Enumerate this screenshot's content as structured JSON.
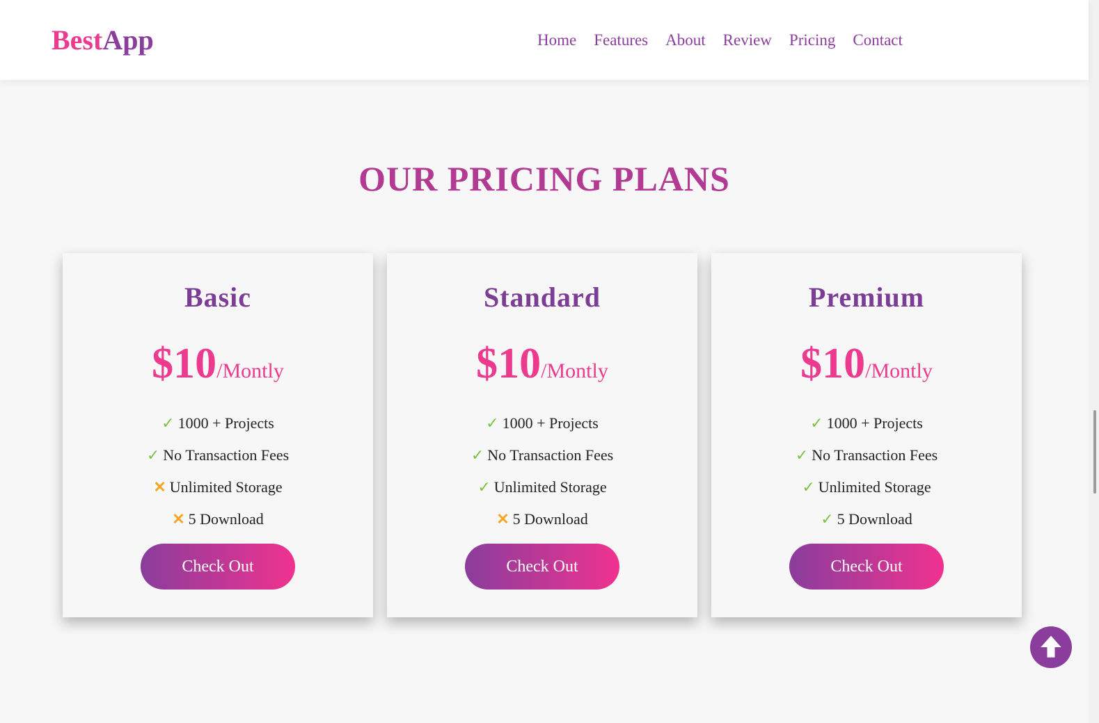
{
  "header": {
    "logo_part1": "Best",
    "logo_part2": "App",
    "nav": [
      "Home",
      "Features",
      "About",
      "Review",
      "Pricing",
      "Contact"
    ]
  },
  "section": {
    "title": "OUR PRICING PLANS"
  },
  "plans": [
    {
      "name": "Basic",
      "price": "$10",
      "period": "/Montly",
      "features": [
        {
          "text": "1000 + Projects",
          "included": true
        },
        {
          "text": "No Transaction Fees",
          "included": true
        },
        {
          "text": "Unlimited Storage",
          "included": false
        },
        {
          "text": "5 Download",
          "included": false
        }
      ],
      "button": "Check Out"
    },
    {
      "name": "Standard",
      "price": "$10",
      "period": "/Montly",
      "features": [
        {
          "text": "1000 + Projects",
          "included": true
        },
        {
          "text": "No Transaction Fees",
          "included": true
        },
        {
          "text": "Unlimited Storage",
          "included": true
        },
        {
          "text": "5 Download",
          "included": false
        }
      ],
      "button": "Check Out"
    },
    {
      "name": "Premium",
      "price": "$10",
      "period": "/Montly",
      "features": [
        {
          "text": "1000 + Projects",
          "included": true
        },
        {
          "text": "No Transaction Fees",
          "included": true
        },
        {
          "text": "Unlimited Storage",
          "included": true
        },
        {
          "text": "5 Download",
          "included": true
        }
      ],
      "button": "Check Out"
    }
  ],
  "icons": {
    "included": "check-icon",
    "excluded": "cross-icon",
    "scroll_top": "arrow-up-circle-icon"
  },
  "colors": {
    "primary": "#8a3d9c",
    "accent": "#ec3a8e",
    "check": "#7cc24a",
    "cross": "#f5a623"
  }
}
